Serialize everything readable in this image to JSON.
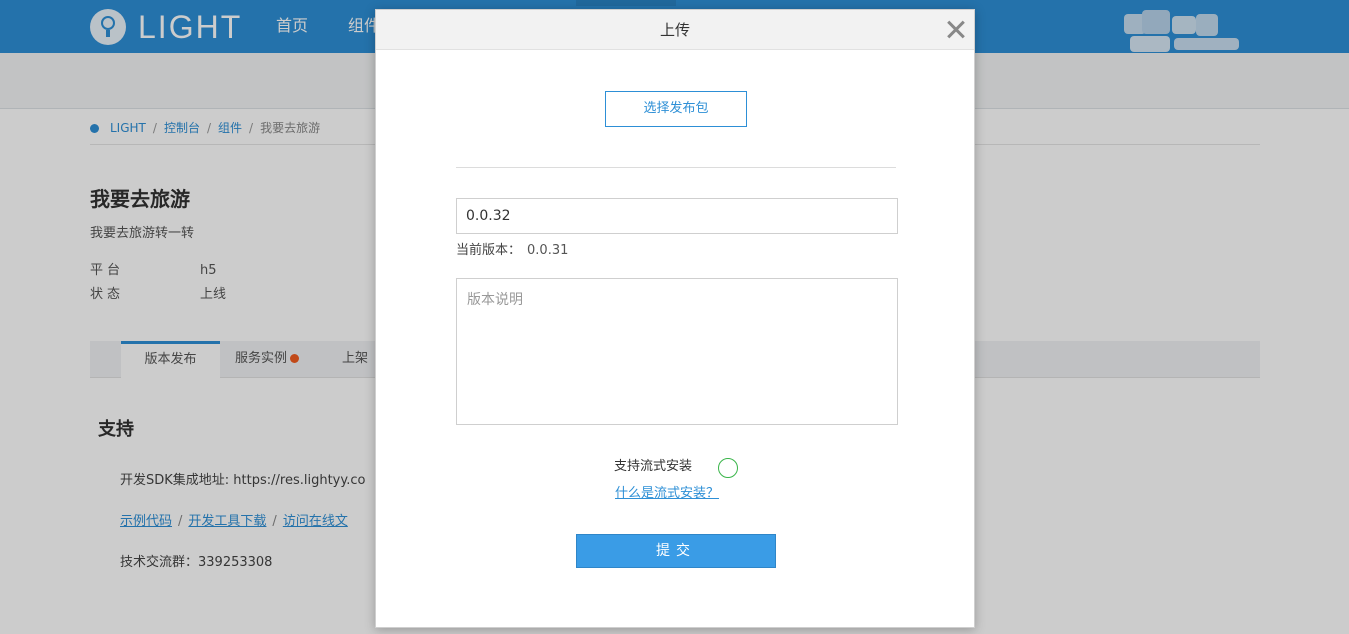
{
  "topbar": {
    "logo_text": "LIGHT",
    "nav": [
      {
        "label": "首页"
      },
      {
        "label": "组件"
      }
    ]
  },
  "breadcrumb": {
    "items": [
      "LIGHT",
      "控制台",
      "组件"
    ],
    "separator": "/",
    "current": "我要去旅游"
  },
  "app": {
    "title": "我要去旅游",
    "description": "我要去旅游转一转",
    "meta": [
      {
        "label": "平台",
        "value": "h5"
      },
      {
        "label": "状态",
        "value": "上线"
      }
    ]
  },
  "tabs": [
    {
      "label": "版本发布",
      "active": true
    },
    {
      "label": "服务实例",
      "badge": true
    },
    {
      "label": "上架"
    }
  ],
  "support": {
    "title": "支持",
    "sdk_line": "开发SDK集成地址: https://res.lightyy.co",
    "links": [
      "示例代码",
      "开发工具下载",
      "访问在线文"
    ],
    "qq_group": "技术交流群：339253308"
  },
  "modal": {
    "title": "上传",
    "choose_button": "选择发布包",
    "version_value": "0.0.32",
    "current_version_label": "当前版本：",
    "current_version_value": "0.0.31",
    "notes_placeholder": "版本说明",
    "stream_label": "支持流式安装",
    "stream_link": "什么是流式安装？",
    "submit_label": "提交"
  },
  "colors": {
    "brand": "#2d8fd6",
    "submit": "#3a9ce6",
    "toggle_border": "#3ab54a",
    "badge": "#f25c1f"
  }
}
